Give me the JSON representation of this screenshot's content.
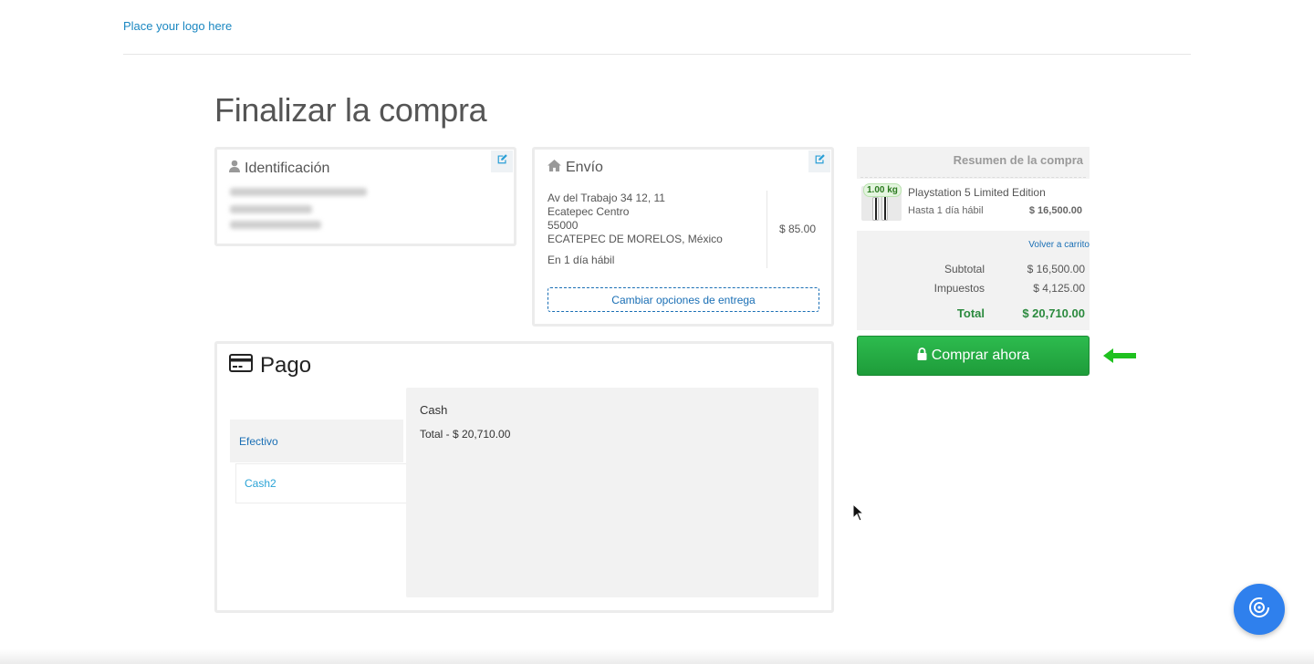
{
  "header": {
    "logo_text": "Place your logo here"
  },
  "page": {
    "title": "Finalizar la compra"
  },
  "identification": {
    "title": "Identificación",
    "icon": "user-icon",
    "edit_icon": "edit-icon"
  },
  "shipping": {
    "title": "Envío",
    "icon": "home-icon",
    "edit_icon": "edit-icon",
    "address_line1": "Av del Trabajo 34 12, 11",
    "address_line2": "Ecatepec Centro",
    "postal_code": "55000",
    "city_country": "ECATEPEC DE MORELOS, México",
    "eta": "En 1 día hábil",
    "price": "$ 85.00",
    "change_button": "Cambiar opciones de entrega"
  },
  "payment": {
    "title": "Pago",
    "icon": "credit-card-icon",
    "tabs": [
      {
        "label": "Efectivo",
        "active": true
      },
      {
        "label": "Cash2",
        "active": false
      }
    ],
    "panel": {
      "method": "Cash",
      "total": "Total - $ 20,710.00"
    }
  },
  "summary": {
    "title": "Resumen de la compra",
    "item": {
      "name": "Playstation 5 Limited Edition",
      "weight": "1.00 kg",
      "delivery": "Hasta 1 día hábil",
      "price": "$ 16,500.00"
    },
    "back_to_cart": "Volver a carrito",
    "subtotal_label": "Subtotal",
    "subtotal_value": "$ 16,500.00",
    "tax_label": "Impuestos",
    "tax_value": "$ 4,125.00",
    "total_label": "Total",
    "total_value": "$ 20,710.00"
  },
  "buy_button": {
    "label": "Comprar ahora",
    "icon": "lock-icon"
  },
  "colors": {
    "accent_blue": "#1a6fb5",
    "buy_green": "#1e9c3a",
    "total_green": "#2b8a3e",
    "fab_blue": "#2f80ed"
  }
}
